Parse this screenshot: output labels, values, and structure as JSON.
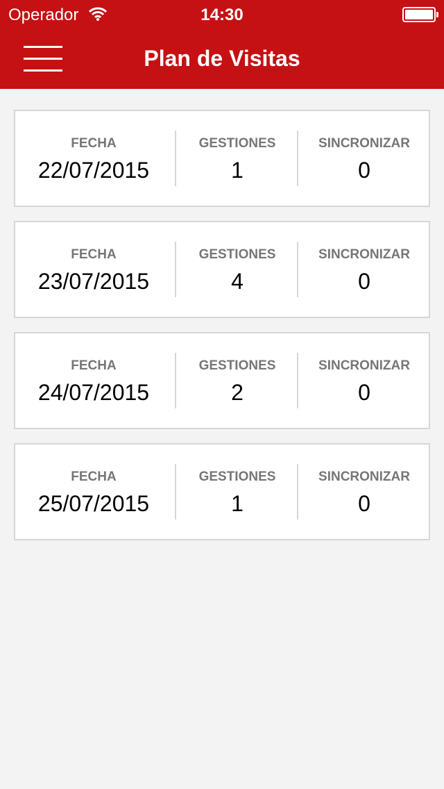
{
  "status_bar": {
    "carrier": "Operador",
    "time": "14:30",
    "wifi_icon": "wifi-icon",
    "battery_icon": "battery-full-icon"
  },
  "header": {
    "title": "Plan de Visitas",
    "menu_icon": "hamburger-menu-icon",
    "background_color": "#c51114"
  },
  "visits": [
    {
      "fecha_label": "FECHA",
      "fecha": "22/07/2015",
      "gestiones_label": "GESTIONES",
      "gestiones": "1",
      "sincronizar_label": "SINCRONIZAR",
      "sincronizar": "0"
    },
    {
      "fecha_label": "FECHA",
      "fecha": "23/07/2015",
      "gestiones_label": "GESTIONES",
      "gestiones": "4",
      "sincronizar_label": "SINCRONIZAR",
      "sincronizar": "0"
    },
    {
      "fecha_label": "FECHA",
      "fecha": "24/07/2015",
      "gestiones_label": "GESTIONES",
      "gestiones": "2",
      "sincronizar_label": "SINCRONIZAR",
      "sincronizar": "0"
    },
    {
      "fecha_label": "FECHA",
      "fecha": "25/07/2015",
      "gestiones_label": "GESTIONES",
      "gestiones": "1",
      "sincronizar_label": "SINCRONIZAR",
      "sincronizar": "0"
    }
  ]
}
